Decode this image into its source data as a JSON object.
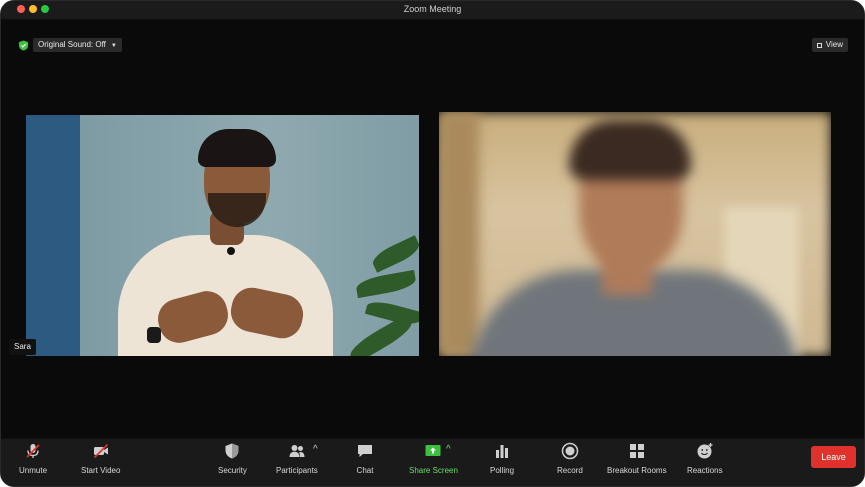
{
  "window": {
    "title": "Zoom Meeting"
  },
  "top_bar": {
    "original_sound_label": "Original Sound: Off",
    "view_label": "View"
  },
  "participants": [
    {
      "name": "Sara"
    }
  ],
  "toolbar": {
    "unmute": "Unmute",
    "start_video": "Start Video",
    "security": "Security",
    "participants": "Participants",
    "chat": "Chat",
    "share_screen": "Share Screen",
    "polling": "Polling",
    "record": "Record",
    "breakout_rooms": "Breakout Rooms",
    "reactions": "Reactions",
    "leave": "Leave"
  },
  "colors": {
    "leave": "#e0322c",
    "share_green": "#6ddc69",
    "shield_green": "#3fbf3f"
  }
}
